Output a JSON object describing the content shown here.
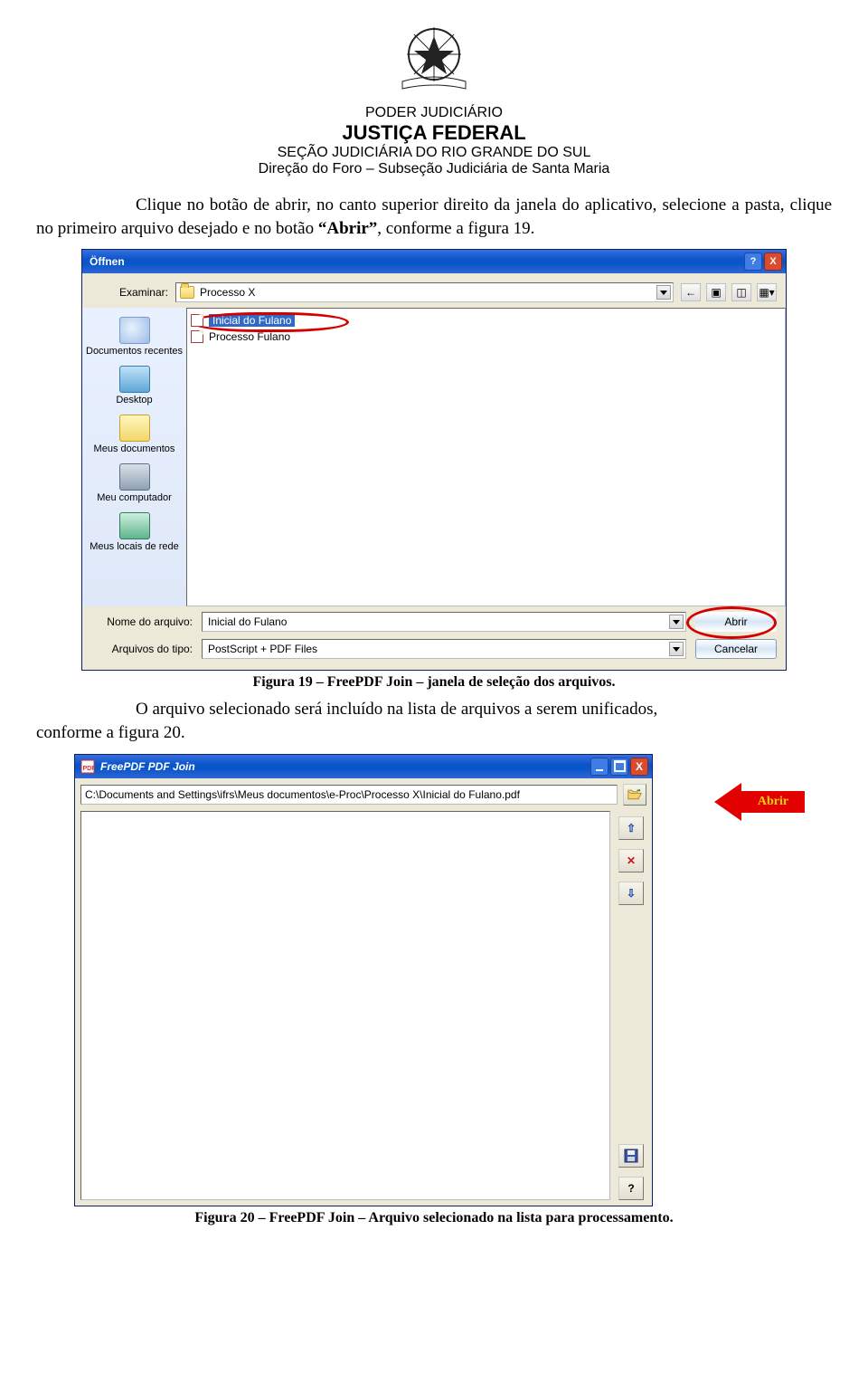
{
  "header": {
    "line1": "PODER JUDICIÁRIO",
    "line2": "JUSTIÇA FEDERAL",
    "line3": "SEÇÃO JUDICIÁRIA DO RIO GRANDE DO SUL",
    "line4": "Direção do Foro – Subseção Judiciária de Santa Maria"
  },
  "paragraph1": {
    "pre": "Clique no botão de abrir, no canto superior direito da janela do aplicativo, selecione a pasta, clique no primeiro arquivo desejado e no botão ",
    "bold": "“Abrir”",
    "post": ", conforme a figura 19."
  },
  "dialog": {
    "title": "Öffnen",
    "help": "?",
    "close": "X",
    "examinar_label": "Examinar:",
    "folder_name": "Processo X",
    "nav": {
      "back": "←",
      "up": "▣",
      "new": "◫",
      "views": "▦▾"
    },
    "places": {
      "recent": "Documentos recentes",
      "desktop": "Desktop",
      "mydocs": "Meus documentos",
      "mycomp": "Meu computador",
      "net": "Meus locais de rede"
    },
    "files": [
      "Inicial do Fulano",
      "Processo Fulano"
    ],
    "file_label": "Nome do arquivo:",
    "file_value": "Inicial do Fulano",
    "type_label": "Arquivos do tipo:",
    "type_value": "PostScript + PDF Files",
    "open_btn": "Abrir",
    "cancel_btn": "Cancelar"
  },
  "caption1": "Figura 19 – FreePDF Join – janela de seleção dos arquivos.",
  "paragraph2": {
    "indent": "O arquivo selecionado será incluído na lista de arquivos a serem unificados,",
    "tail": "conforme a figura 20."
  },
  "join": {
    "title": "FreePDF PDF Join",
    "icon_text": "PDF",
    "path": "C:\\Documents and Settings\\ifrs\\Meus documentos\\e-Proc\\Processo X\\Inicial do Fulano.pdf",
    "side": {
      "up": "⇧",
      "del": "✕",
      "down": "⇩",
      "save": "💾",
      "help": "?"
    },
    "min": "",
    "max": "",
    "close": "X"
  },
  "callout": {
    "label": "Abrir"
  },
  "caption2": "Figura 20 – FreePDF Join – Arquivo selecionado na lista para processamento."
}
